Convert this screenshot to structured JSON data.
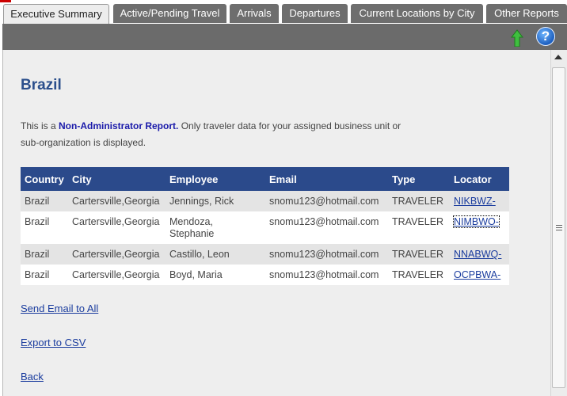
{
  "tabs": [
    {
      "label": "Executive Summary",
      "active": true
    },
    {
      "label": "Active/Pending Travel"
    },
    {
      "label": "Arrivals"
    },
    {
      "label": "Departures"
    },
    {
      "label": "Current Locations by City"
    },
    {
      "label": "Other Reports"
    }
  ],
  "toolbar": {
    "icons": [
      "back-arrow-icon",
      "help-icon"
    ],
    "help_glyph": "?"
  },
  "page": {
    "title": "Brazil",
    "notice_prefix": "This is a ",
    "notice_bold": "Non-Administrator Report.",
    "notice_line1_rest": " Only traveler data for your assigned business unit or",
    "notice_line2": "sub-organization is displayed."
  },
  "table": {
    "headers": [
      "Country",
      "City",
      "Employee",
      "Email",
      "Type",
      "Locator"
    ],
    "rows": [
      {
        "country": "Brazil",
        "city": "Cartersville,Georgia",
        "employee": "Jennings, Rick",
        "email": "snomu123@hotmail.com",
        "type": "TRAVELER",
        "locator": "NIKBWZ-"
      },
      {
        "country": "Brazil",
        "city": "Cartersville,Georgia",
        "employee": "Mendoza,",
        "employee2": "Stephanie",
        "email": "snomu123@hotmail.com",
        "type": "TRAVELER",
        "locator": "NIMBWO-"
      },
      {
        "country": "Brazil",
        "city": "Cartersville,Georgia",
        "employee": "Castillo, Leon",
        "email": "snomu123@hotmail.com",
        "type": "TRAVELER",
        "locator": "NNABWQ-"
      },
      {
        "country": "Brazil",
        "city": "Cartersville,Georgia",
        "employee": "Boyd, Maria",
        "email": "snomu123@hotmail.com",
        "type": "TRAVELER",
        "locator": "OCPBWA-"
      }
    ]
  },
  "links": {
    "send_email": "Send Email to All",
    "export_csv": "Export to CSV",
    "back": "Back"
  },
  "colors": {
    "header_bg": "#2b4a8b",
    "title": "#2b4f8c",
    "toolbar": "#6b6b6b"
  }
}
